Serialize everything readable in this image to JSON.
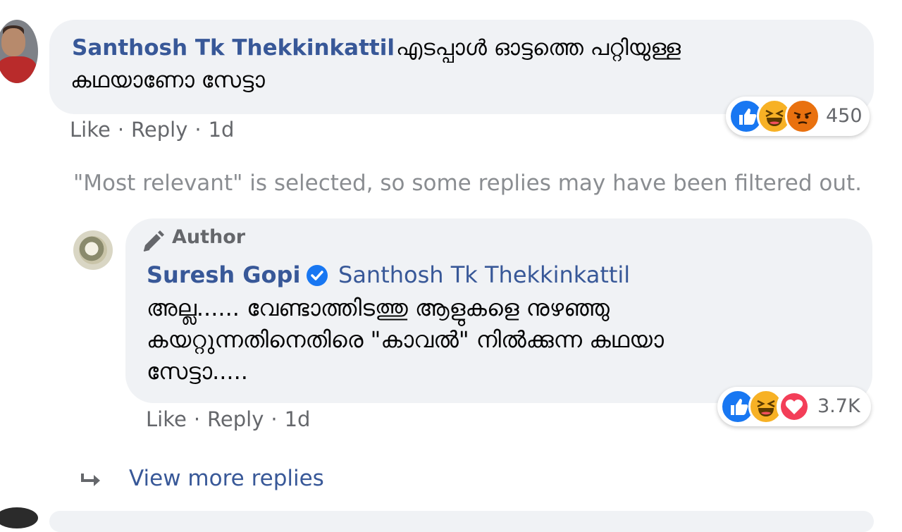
{
  "comment1": {
    "author": "Santhosh Tk Thekkinkattil",
    "text_line1": "എടപ്പാൾ ഓട്ടത്തെ പറ്റിയുള്ള",
    "text_line2": "കഥയാണോ സേട്ടാ",
    "reaction_count": "450",
    "reactions": [
      "like-icon",
      "haha-icon",
      "angry-icon"
    ],
    "actions": {
      "like": "Like",
      "reply": "Reply",
      "time": "1d",
      "separator": "·"
    }
  },
  "filter_note": "\"Most relevant\" is selected, so some replies may have been filtered out.",
  "reply1": {
    "badge": "Author",
    "author": "Suresh Gopi",
    "tagged_user": "Santhosh Tk Thekkinkattil",
    "text_line1": "അല്ല...... വേണ്ടാത്തിടത്തു ആളുകളെ നുഴഞ്ഞു",
    "text_line2": "കയറ്റുന്നതിനെതിരെ \"കാവൽ\" നിൽക്കുന്ന കഥയാ",
    "text_line3": "സേട്ടാ.....",
    "reaction_count": "3.7K",
    "reactions": [
      "like-icon",
      "haha-icon",
      "love-icon"
    ],
    "actions": {
      "like": "Like",
      "reply": "Reply",
      "time": "1d",
      "separator": "·"
    }
  },
  "view_more": "View more replies",
  "colors": {
    "link": "#385898",
    "muted": "#65676b",
    "bubble": "#f0f2f5",
    "like_blue": "#1877f2",
    "haha_yellow": "#f7b125",
    "angry_orange": "#e9710f",
    "love_red": "#f33e58"
  }
}
